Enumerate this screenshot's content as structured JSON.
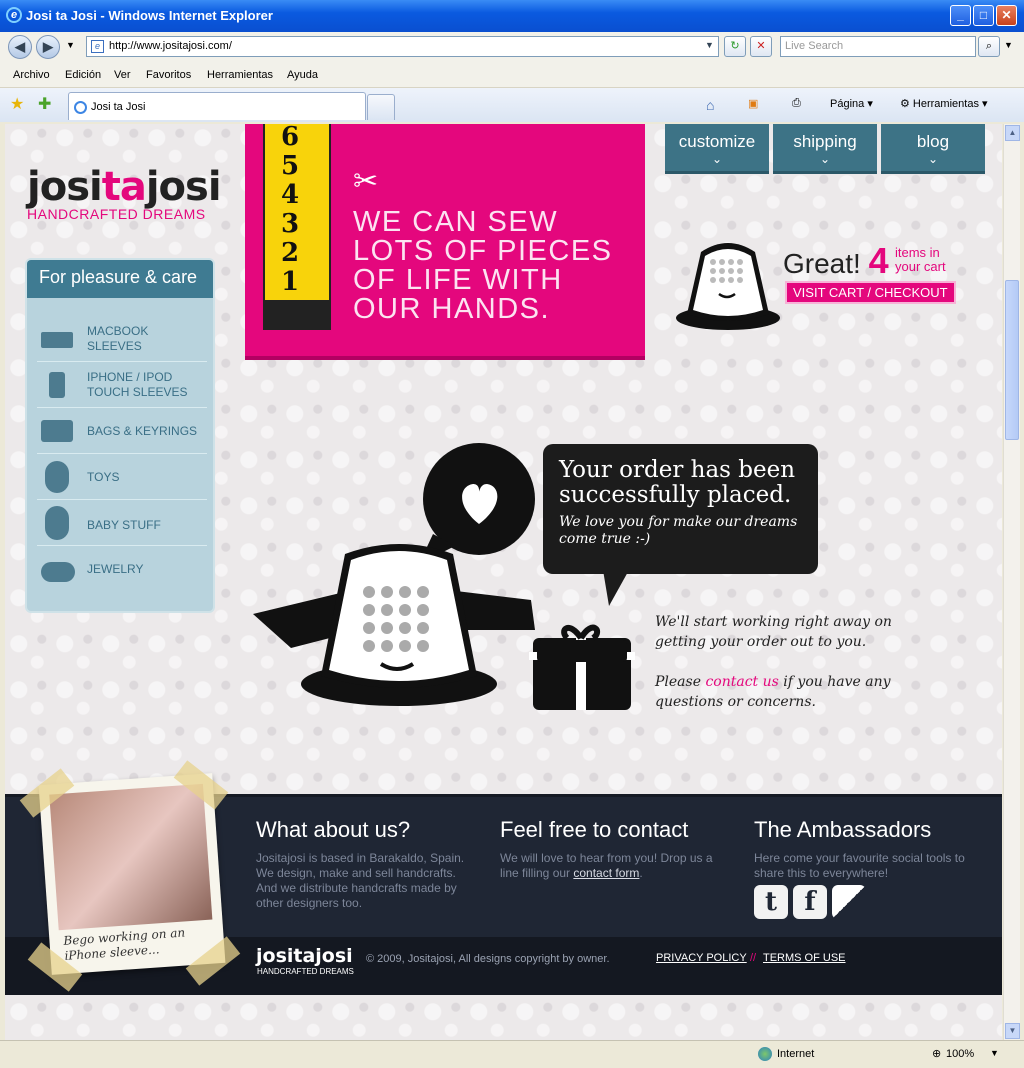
{
  "window": {
    "title": "Josi ta Josi - Windows Internet Explorer",
    "url": "http://www.jositajosi.com/",
    "search_placeholder": "Live Search",
    "menu": [
      "Archivo",
      "Edición",
      "Ver",
      "Favoritos",
      "Herramientas",
      "Ayuda"
    ],
    "tab_label": "Josi ta Josi",
    "toolbar": {
      "page": "Página",
      "tools": "Herramientas"
    },
    "status": {
      "zone": "Internet",
      "zoom": "100%"
    }
  },
  "site": {
    "logo": {
      "part1": "josi",
      "part2": "ta",
      "part3": "josi",
      "tagline": "HANDCRAFTED DREAMS"
    },
    "sidebar": {
      "title": "For pleasure & care",
      "items": [
        {
          "label": "MACBOOK SLEEVES",
          "icon": "laptop-icon"
        },
        {
          "label": "IPHONE / IPOD TOUCH SLEEVES",
          "icon": "phone-icon"
        },
        {
          "label": "BAGS & KEYRINGS",
          "icon": "bag-icon"
        },
        {
          "label": "TOYS",
          "icon": "teddy-bear-icon"
        },
        {
          "label": "BABY STUFF",
          "icon": "bib-icon"
        },
        {
          "label": "JEWELRY",
          "icon": "cherries-icon"
        }
      ]
    },
    "ruler_numbers": [
      "6",
      "5",
      "4",
      "3",
      "2",
      "1"
    ],
    "slogan": "WE CAN SEW LOTS OF PIECES OF LIFE WITH OUR HANDS.",
    "nav": [
      "customize",
      "shipping",
      "blog"
    ],
    "cart": {
      "great": "Great!",
      "count": "4",
      "items_text": "items in your cart",
      "button": "VISIT CART / CHECKOUT"
    },
    "order": {
      "heading": "Your order has been successfully placed.",
      "subtext": "We love you for make our dreams come true :-)",
      "message1": "We'll start working right away on getting your order out to you.",
      "message2_pre": "Please ",
      "message2_link": "contact us",
      "message2_post": " if you have any questions or concerns."
    },
    "footer": {
      "about_title": "What about us?",
      "about_text": "Jositajosi is based in Barakaldo, Spain. We design, make and sell handcrafts. And we distribute handcrafts made by other designers too.",
      "contact_title": "Feel free to contact",
      "contact_text_pre": "We will love to hear from you! Drop us a line filling our ",
      "contact_link": "contact form",
      "contact_text_post": ".",
      "ambassadors_title": "The Ambassadors",
      "ambassadors_text": "Here come your favourite social tools to share this to everywhere!",
      "polaroid_caption": "Bego working on an iPhone sleeve...",
      "logo_small": "jositajosi",
      "logo_small_tag": "HANDCRAFTED DREAMS",
      "copyright": "© 2009, Jositajosi, All designs copyright by owner.",
      "privacy": "PRIVACY POLICY",
      "sep": "//",
      "terms": "TERMS OF USE"
    }
  }
}
